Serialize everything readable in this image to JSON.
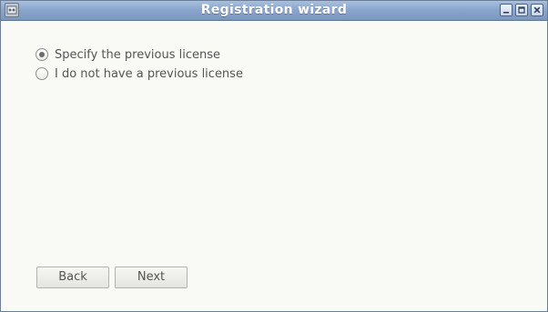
{
  "window": {
    "title": "Registration wizard",
    "icons": {
      "app": "app-icon",
      "minimize": "minimize-icon",
      "maximize": "maximize-icon",
      "close": "close-icon"
    }
  },
  "options": {
    "items": [
      {
        "label": "Specify the previous license",
        "checked": true
      },
      {
        "label": "I do not have a previous license",
        "checked": false
      }
    ]
  },
  "buttons": {
    "back_label": "Back",
    "next_label": "Next"
  },
  "colors": {
    "titlebar": "#8aa6cc",
    "background": "#f9f9f5",
    "text": "#555555"
  }
}
